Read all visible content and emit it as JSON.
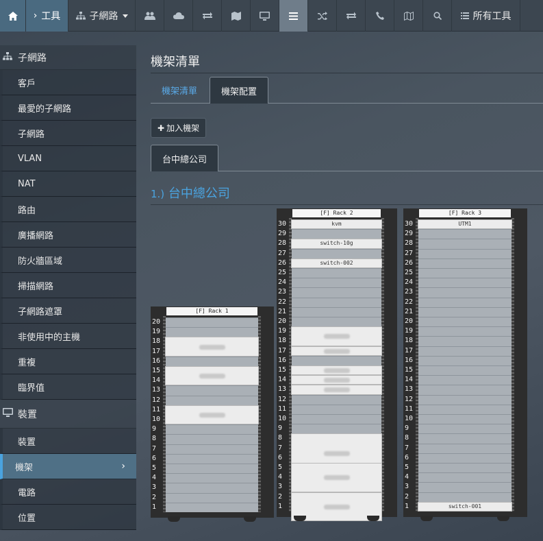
{
  "topbar": {
    "tools_label": "工具",
    "subnet_label": "子網路",
    "all_tools_label": "所有工具"
  },
  "sidebar": {
    "subnet_section": "子網路",
    "subnet_items": [
      "客戶",
      "最愛的子網路",
      "子網路",
      "VLAN",
      "NAT",
      "路由",
      "廣播網路",
      "防火牆區域",
      "掃描網路",
      "子網路遮罩",
      "非使用中的主機",
      "重複",
      "臨界值"
    ],
    "device_section": "裝置",
    "device_items": [
      "裝置",
      "機架",
      "電路",
      "位置"
    ],
    "active_item": "機架"
  },
  "main": {
    "title": "機架清單",
    "tabs": [
      "機架清單",
      "機架配置"
    ],
    "add_button": "加入機架",
    "location_tab": "台中總公司",
    "section_number": "1.)",
    "section_name": "台中總公司"
  },
  "racks": [
    {
      "title": "[F] Rack 1",
      "units": 20,
      "devices": [
        {
          "start": 18,
          "size": 2,
          "label": ""
        },
        {
          "start": 15,
          "size": 2,
          "label": ""
        },
        {
          "start": 11,
          "size": 2,
          "label": ""
        }
      ]
    },
    {
      "title": "[F] Rack 2",
      "units": 30,
      "devices": [
        {
          "start": 30,
          "size": 1,
          "label": "kvm"
        },
        {
          "start": 28,
          "size": 1,
          "label": "switch-10g"
        },
        {
          "start": 26,
          "size": 1,
          "label": "switch-002"
        },
        {
          "start": 19,
          "size": 2,
          "label": ""
        },
        {
          "start": 17,
          "size": 1,
          "label": ""
        },
        {
          "start": 15,
          "size": 1,
          "label": ""
        },
        {
          "start": 14,
          "size": 1,
          "label": ""
        },
        {
          "start": 13,
          "size": 1,
          "label": ""
        },
        {
          "start": 8,
          "size": 4,
          "label": ""
        },
        {
          "start": 5,
          "size": 3,
          "label": ""
        },
        {
          "start": 2,
          "size": 3,
          "label": ""
        }
      ]
    },
    {
      "title": "[F] Rack 3",
      "units": 30,
      "devices": [
        {
          "start": 30,
          "size": 1,
          "label": "UTM1"
        },
        {
          "start": 1,
          "size": 1,
          "label": "switch-001"
        }
      ]
    }
  ]
}
